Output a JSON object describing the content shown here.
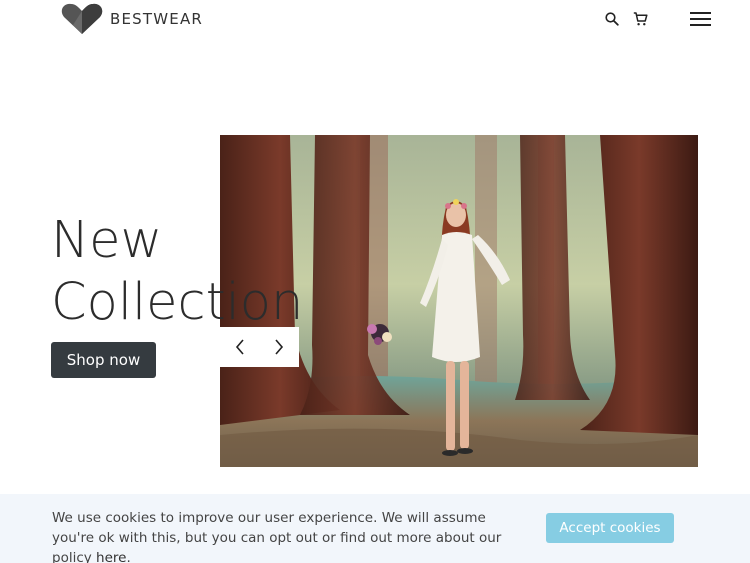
{
  "header": {
    "brand": "BESTWEAR",
    "logo_icon": "heart-logo-icon",
    "search_icon": "search-icon",
    "cart_icon": "cart-icon",
    "menu_icon": "hamburger-menu-icon"
  },
  "hero": {
    "title_line1": "New",
    "title_line2": "Collection",
    "cta_label": "Shop now",
    "image_description_icon": "hero-photo",
    "prev_icon": "chevron-left-icon",
    "next_icon": "chevron-right-icon"
  },
  "cookie_banner": {
    "text_before_link": "We use cookies to improve our user experience. We will assume you're ok with this, but you can opt out or find out more about our policy ",
    "link_label": "here",
    "text_after_link": ".",
    "accept_label": "Accept cookies"
  },
  "colors": {
    "cta_bg": "#353b40",
    "accept_bg": "#86cde3",
    "banner_bg": "#f2f6fb"
  }
}
